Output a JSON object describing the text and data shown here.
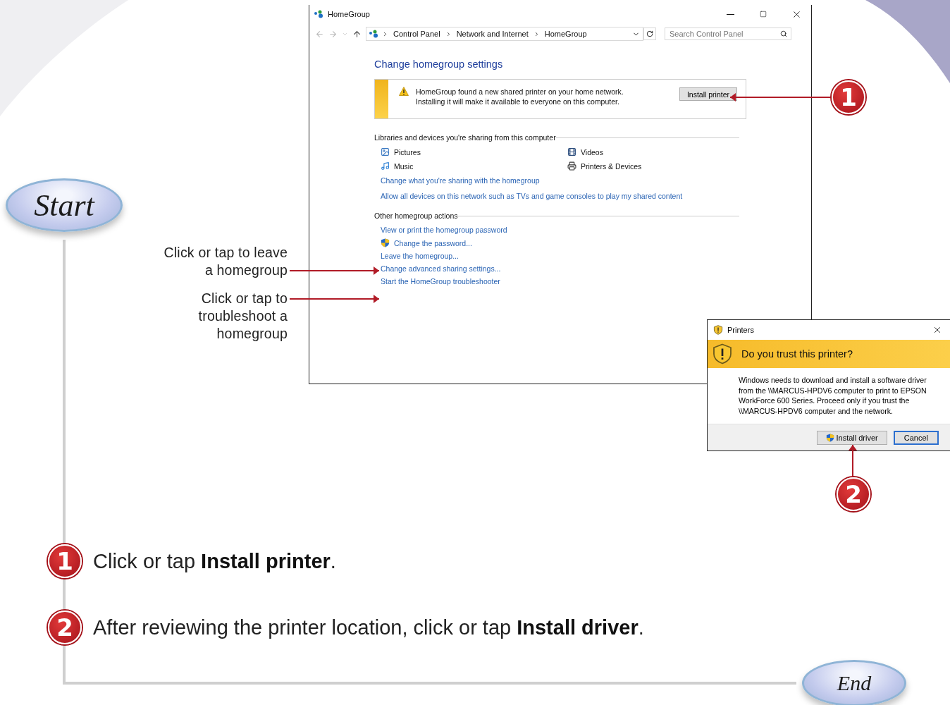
{
  "window": {
    "title": "HomeGroup",
    "breadcrumb": [
      "Control Panel",
      "Network and Internet",
      "HomeGroup"
    ],
    "search": {
      "placeholder": "Search Control Panel"
    },
    "heading": "Change homegroup settings",
    "notice": {
      "lines": [
        "HomeGroup found a new shared printer on your home network.",
        "Installing it will make it available to everyone on this computer."
      ],
      "button": "Install printer"
    },
    "sharing": {
      "title": "Libraries and devices you're sharing from this computer",
      "items": [
        {
          "label": "Pictures",
          "kind": "pictures"
        },
        {
          "label": "Videos",
          "kind": "videos"
        },
        {
          "label": "Music",
          "kind": "music"
        },
        {
          "label": "Printers & Devices",
          "kind": "printers"
        }
      ],
      "links": [
        {
          "label": "Change what you're sharing with the homegroup",
          "shield": false
        },
        {
          "label": "Allow all devices on this network such as TVs and game consoles to play my shared content",
          "shield": false
        }
      ]
    },
    "actions": {
      "title": "Other homegroup actions",
      "links": [
        {
          "label": "View or print the homegroup password",
          "shield": false
        },
        {
          "label": "Change the password...",
          "shield": true
        },
        {
          "label": "Leave the homegroup...",
          "shield": false
        },
        {
          "label": "Change advanced sharing settings...",
          "shield": false
        },
        {
          "label": "Start the HomeGroup troubleshooter",
          "shield": false
        }
      ]
    }
  },
  "dialog": {
    "title": "Printers",
    "question": "Do you trust this printer?",
    "message": "Windows needs to download and install a software driver from the \\\\MARCUS-HPDV6 computer to print to EPSON WorkForce 600 Series.  Proceed only if you trust the \\\\MARCUS-HPDV6 computer and the network.",
    "buttons": [
      {
        "label": "Install driver",
        "shield": true
      },
      {
        "label": "Cancel",
        "shield": false
      }
    ]
  },
  "start_label": "Start",
  "end_label": "End",
  "captions": [
    "Click or tap to leave\na homegroup",
    "Click or tap to\ntroubleshoot a\nhomegroup"
  ],
  "callouts": [
    "1",
    "2"
  ],
  "steps": [
    {
      "number": "1",
      "text": "Click or tap **Install printer**."
    },
    {
      "number": "2",
      "text": "After reviewing the printer location, click or tap **Install driver**."
    }
  ]
}
